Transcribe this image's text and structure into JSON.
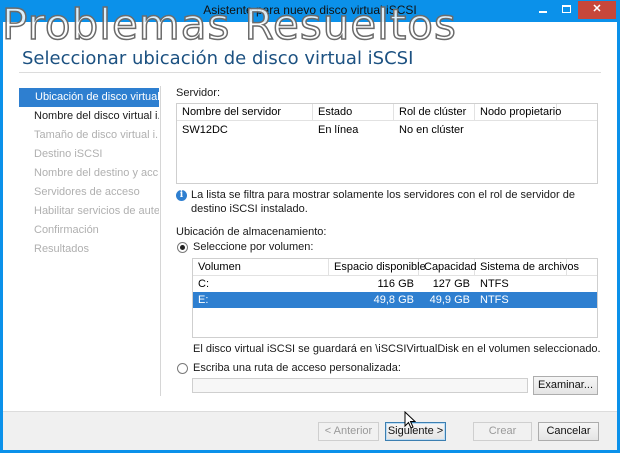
{
  "window": {
    "title": "Asistente para nuevo disco virtual iSCSI",
    "minimize": "minimize",
    "maximize": "maximize",
    "close": "✕"
  },
  "watermark": "Problemas Resueltos",
  "page_title": "Seleccionar ubicación de disco virtual iSCSI",
  "nav": {
    "items": [
      {
        "label": "Ubicación de disco virtual..."
      },
      {
        "label": "Nombre del disco virtual i..."
      },
      {
        "label": "Tamaño de disco virtual i..."
      },
      {
        "label": "Destino iSCSI"
      },
      {
        "label": "Nombre del destino y acc..."
      },
      {
        "label": "Servidores de acceso"
      },
      {
        "label": "Habilitar servicios de aute..."
      },
      {
        "label": "Confirmación"
      },
      {
        "label": "Resultados"
      }
    ]
  },
  "server": {
    "label": "Servidor:",
    "columns": [
      "Nombre del servidor",
      "Estado",
      "Rol de clúster",
      "Nodo propietario"
    ],
    "rows": [
      [
        "SW12DC",
        "En línea",
        "No en clúster",
        ""
      ]
    ]
  },
  "info_text": "La lista se filtra para mostrar solamente los servidores con el rol de servidor de destino iSCSI instalado.",
  "storage": {
    "label": "Ubicación de almacenamiento:",
    "by_volume_label": "Seleccione por volumen:",
    "columns": [
      "Volumen",
      "Espacio disponible",
      "Capacidad",
      "Sistema de archivos"
    ],
    "rows": [
      [
        "C:",
        "116 GB",
        "127 GB",
        "NTFS"
      ],
      [
        "E:",
        "49,8 GB",
        "49,9 GB",
        "NTFS"
      ]
    ],
    "selected_row": 1,
    "note": "El disco virtual iSCSI se guardará en \\iSCSIVirtualDisk en el volumen seleccionado.",
    "custom_path_label": "Escriba una ruta de acceso personalizada:",
    "custom_path_value": "",
    "browse_label": "Examinar..."
  },
  "buttons": {
    "previous": "< Anterior",
    "next": "Siguiente >",
    "create": "Crear",
    "cancel": "Cancelar"
  },
  "icons": {
    "info": "info-icon",
    "cursor": "mouse-pointer-icon"
  },
  "colors": {
    "titlebar": "#0b91ea",
    "selection": "#2e7fd0",
    "title_text": "#1c5181",
    "close_button": "#c7473b"
  }
}
